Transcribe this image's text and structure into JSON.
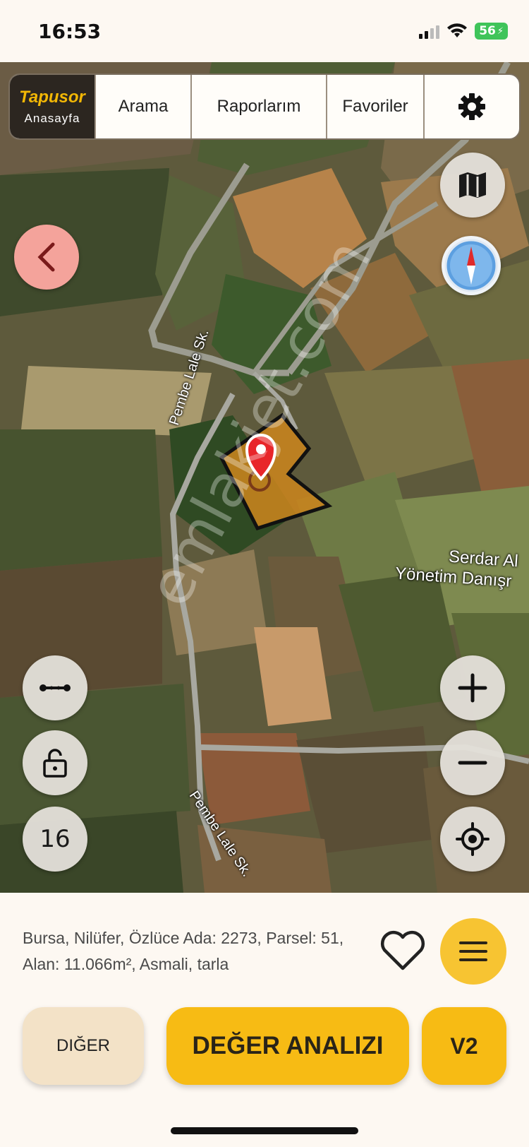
{
  "status_bar": {
    "time": "16:53",
    "battery": "56"
  },
  "nav": {
    "brand": "Tapusor",
    "home_label": "Anasayfa",
    "tabs": [
      "Arama",
      "Raporlarım",
      "Favoriler"
    ],
    "settings_icon": "gear-icon"
  },
  "map": {
    "street_labels": [
      "Pembe Lale Sk.",
      "Pembe Lale Sk."
    ],
    "poi_lines": [
      "Serdar Al",
      "Yönetim Danışr"
    ],
    "watermark": "emlakjet.com",
    "zoom_level": "16",
    "parcel_color": "#c9841e",
    "pin_color": "#e8262a",
    "controls": {
      "left": [
        "measure-icon",
        "lock-icon",
        "zoom-level"
      ],
      "right": [
        "map-layers-icon",
        "compass-icon",
        "zoom-in-icon",
        "zoom-out-icon",
        "locate-icon"
      ]
    }
  },
  "parcel_info": {
    "text": "Bursa, Nilüfer, Özlüce Ada: 2273, Parsel: 51, Alan: 11.066m², Asmali, tarla"
  },
  "actions": {
    "other_label": "DIĞER",
    "value_analysis_label": "DEĞER ANALIZI",
    "version_label": "V2"
  },
  "colors": {
    "accent": "#f7bb14",
    "background": "#fdf8f2",
    "back_button": "#f4a39b"
  }
}
